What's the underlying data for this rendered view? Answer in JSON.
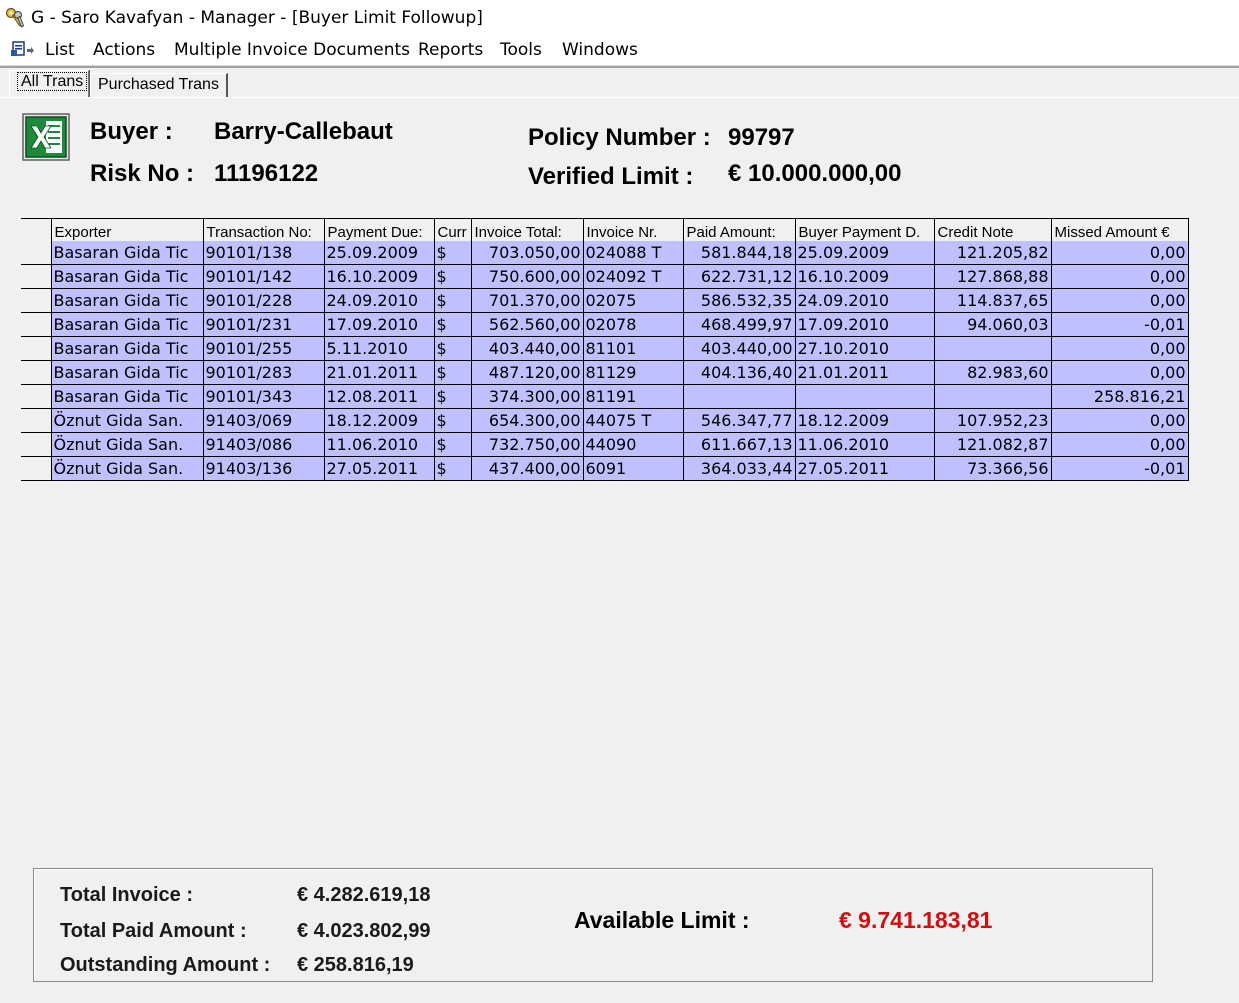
{
  "window": {
    "title": "G - Saro Kavafyan - Manager - [Buyer Limit Followup]",
    "app_icon": "keys-icon"
  },
  "menu": {
    "items": [
      "List",
      "Actions",
      "Multiple Invoice Documents",
      "Reports",
      "Tools",
      "Windows"
    ]
  },
  "tabs": [
    {
      "label": "All Trans",
      "active": true
    },
    {
      "label": "Purchased Trans",
      "active": false
    }
  ],
  "header": {
    "buyer_label": "Buyer :",
    "buyer_value": "Barry-Callebaut",
    "risk_label": "Risk No :",
    "risk_value": "11196122",
    "policy_label": "Policy Number :",
    "policy_value": "99797",
    "limit_label": "Verified Limit :",
    "limit_value": "€ 10.000.000,00",
    "export_icon": "excel-icon"
  },
  "table": {
    "columns": [
      "Exporter",
      "Transaction No:",
      "Payment Due:",
      "Curr",
      "Invoice Total:",
      "Invoice Nr.",
      "Paid Amount:",
      "Buyer Payment D.",
      "Credit Note",
      "Missed Amount €"
    ],
    "rows": [
      [
        "Basaran Gida Tic",
        "90101/138",
        "25.09.2009",
        "$",
        "703.050,00",
        "024088 T",
        "581.844,18",
        "25.09.2009",
        "121.205,82",
        "0,00"
      ],
      [
        "Basaran Gida Tic",
        "90101/142",
        "16.10.2009",
        "$",
        "750.600,00",
        "024092 T",
        "622.731,12",
        "16.10.2009",
        "127.868,88",
        "0,00"
      ],
      [
        "Basaran Gida Tic",
        "90101/228",
        "24.09.2010",
        "$",
        "701.370,00",
        "02075",
        "586.532,35",
        "24.09.2010",
        "114.837,65",
        "0,00"
      ],
      [
        "Basaran Gida Tic",
        "90101/231",
        "17.09.2010",
        "$",
        "562.560,00",
        "02078",
        "468.499,97",
        "17.09.2010",
        "94.060,03",
        "-0,01"
      ],
      [
        "Basaran Gida Tic",
        "90101/255",
        "5.11.2010",
        "$",
        "403.440,00",
        "81101",
        "403.440,00",
        "27.10.2010",
        "",
        "0,00"
      ],
      [
        "Basaran Gida Tic",
        "90101/283",
        "21.01.2011",
        "$",
        "487.120,00",
        "81129",
        "404.136,40",
        "21.01.2011",
        "82.983,60",
        "0,00"
      ],
      [
        "Basaran Gida Tic",
        "90101/343",
        "12.08.2011",
        "$",
        "374.300,00",
        "81191",
        "",
        "",
        "",
        "258.816,21"
      ],
      [
        "Öznut Gida San.",
        "91403/069",
        "18.12.2009",
        "$",
        "654.300,00",
        "44075 T",
        "546.347,77",
        "18.12.2009",
        "107.952,23",
        "0,00"
      ],
      [
        "Öznut Gida San.",
        "91403/086",
        "11.06.2010",
        "$",
        "732.750,00",
        "44090",
        "611.667,13",
        "11.06.2010",
        "121.082,87",
        "0,00"
      ],
      [
        "Öznut Gida San.",
        "91403/136",
        "27.05.2011",
        "$",
        "437.400,00",
        "6091",
        "364.033,44",
        "27.05.2011",
        "73.366,56",
        "-0,01"
      ]
    ]
  },
  "summary": {
    "total_invoice_label": "Total Invoice :",
    "total_invoice_value": "€ 4.282.619,18",
    "total_paid_label": "Total Paid Amount :",
    "total_paid_value": "€ 4.023.802,99",
    "outstanding_label": "Outstanding Amount :",
    "outstanding_value": "€ 258.816,19",
    "available_label": "Available Limit :",
    "available_value": "€ 9.741.183,81",
    "available_color": "#d01010"
  }
}
